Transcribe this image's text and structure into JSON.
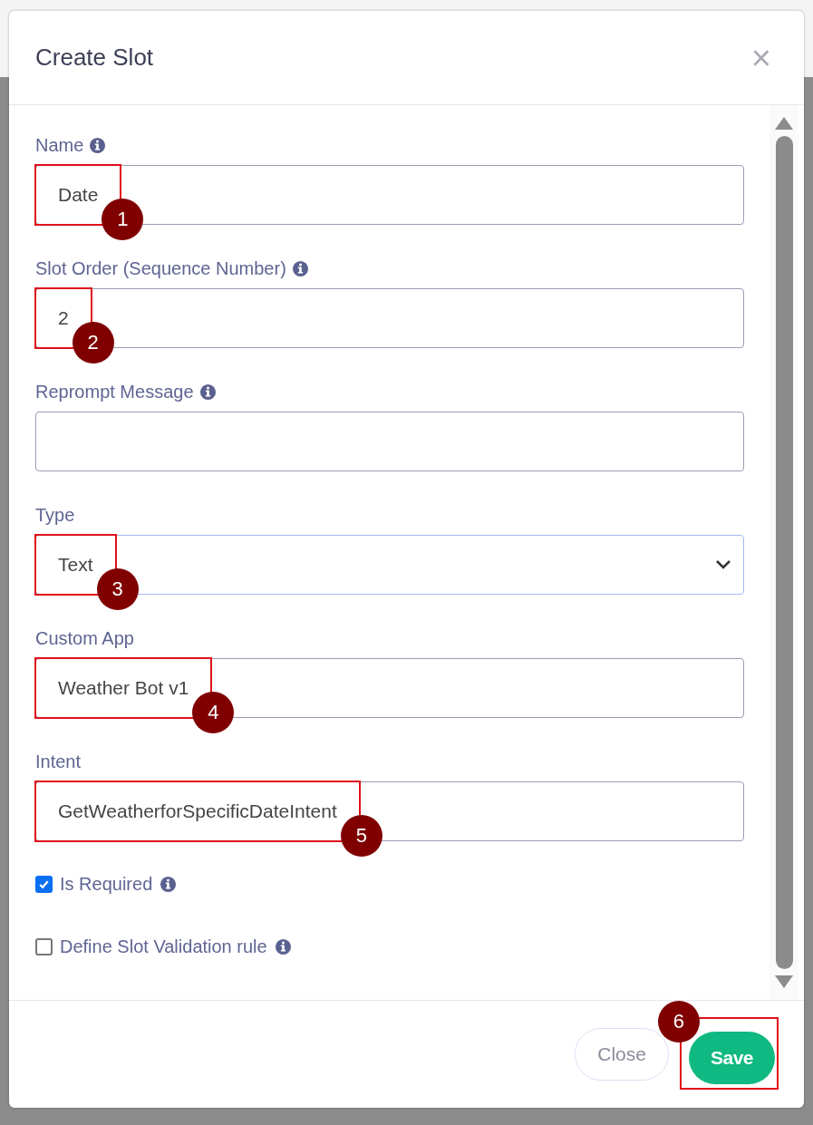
{
  "dialog": {
    "title": "Create Slot",
    "close_icon": "×"
  },
  "fields": [
    {
      "kind": "text",
      "label": "Name",
      "info": true,
      "value": "Date",
      "callout": "1"
    },
    {
      "kind": "text",
      "label": "Slot Order (Sequence Number)",
      "info": true,
      "value": "2",
      "callout": "2"
    },
    {
      "kind": "text",
      "label": "Reprompt Message",
      "info": true
    },
    {
      "kind": "select",
      "label": "Type",
      "info": false,
      "value": "Text",
      "callout": "3"
    },
    {
      "kind": "text",
      "label": "Custom App",
      "info": false,
      "value": "Weather Bot v1",
      "callout": "4"
    },
    {
      "kind": "text",
      "label": "Intent",
      "info": false,
      "value": "GetWeatherforSpecificDateIntent",
      "callout": "5"
    },
    {
      "kind": "checkbox",
      "label": "Is Required",
      "info": true,
      "checked": true
    },
    {
      "kind": "checkbox",
      "label": "Define Slot Validation rule",
      "info": true,
      "checked": false
    }
  ],
  "buttons": [
    {
      "kind": "secondary",
      "label": "Close"
    },
    {
      "kind": "primary",
      "label": "Save",
      "callout": "6"
    }
  ]
}
